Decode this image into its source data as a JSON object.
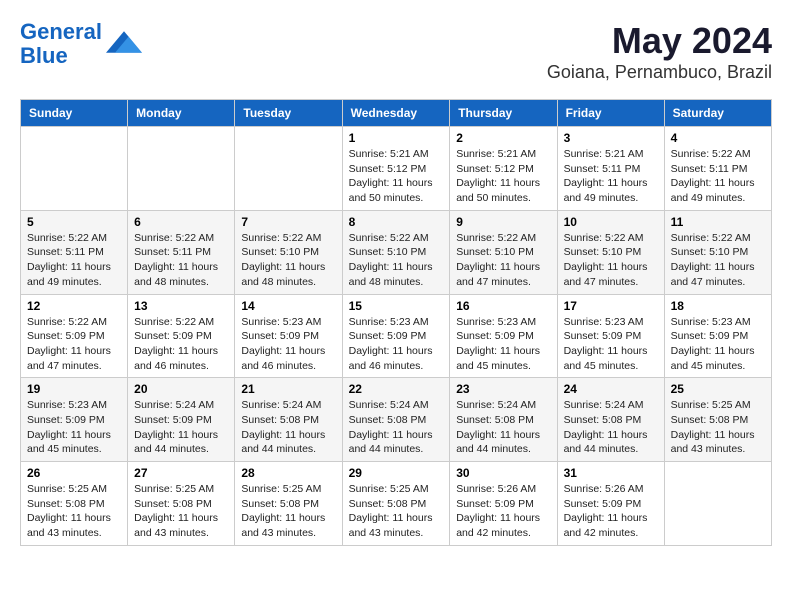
{
  "logo": {
    "line1": "General",
    "line2": "Blue"
  },
  "title": {
    "month_year": "May 2024",
    "location": "Goiana, Pernambuco, Brazil"
  },
  "days_of_week": [
    "Sunday",
    "Monday",
    "Tuesday",
    "Wednesday",
    "Thursday",
    "Friday",
    "Saturday"
  ],
  "weeks": [
    [
      {
        "day": "",
        "info": ""
      },
      {
        "day": "",
        "info": ""
      },
      {
        "day": "",
        "info": ""
      },
      {
        "day": "1",
        "info": "Sunrise: 5:21 AM\nSunset: 5:12 PM\nDaylight: 11 hours\nand 50 minutes."
      },
      {
        "day": "2",
        "info": "Sunrise: 5:21 AM\nSunset: 5:12 PM\nDaylight: 11 hours\nand 50 minutes."
      },
      {
        "day": "3",
        "info": "Sunrise: 5:21 AM\nSunset: 5:11 PM\nDaylight: 11 hours\nand 49 minutes."
      },
      {
        "day": "4",
        "info": "Sunrise: 5:22 AM\nSunset: 5:11 PM\nDaylight: 11 hours\nand 49 minutes."
      }
    ],
    [
      {
        "day": "5",
        "info": "Sunrise: 5:22 AM\nSunset: 5:11 PM\nDaylight: 11 hours\nand 49 minutes."
      },
      {
        "day": "6",
        "info": "Sunrise: 5:22 AM\nSunset: 5:11 PM\nDaylight: 11 hours\nand 48 minutes."
      },
      {
        "day": "7",
        "info": "Sunrise: 5:22 AM\nSunset: 5:10 PM\nDaylight: 11 hours\nand 48 minutes."
      },
      {
        "day": "8",
        "info": "Sunrise: 5:22 AM\nSunset: 5:10 PM\nDaylight: 11 hours\nand 48 minutes."
      },
      {
        "day": "9",
        "info": "Sunrise: 5:22 AM\nSunset: 5:10 PM\nDaylight: 11 hours\nand 47 minutes."
      },
      {
        "day": "10",
        "info": "Sunrise: 5:22 AM\nSunset: 5:10 PM\nDaylight: 11 hours\nand 47 minutes."
      },
      {
        "day": "11",
        "info": "Sunrise: 5:22 AM\nSunset: 5:10 PM\nDaylight: 11 hours\nand 47 minutes."
      }
    ],
    [
      {
        "day": "12",
        "info": "Sunrise: 5:22 AM\nSunset: 5:09 PM\nDaylight: 11 hours\nand 47 minutes."
      },
      {
        "day": "13",
        "info": "Sunrise: 5:22 AM\nSunset: 5:09 PM\nDaylight: 11 hours\nand 46 minutes."
      },
      {
        "day": "14",
        "info": "Sunrise: 5:23 AM\nSunset: 5:09 PM\nDaylight: 11 hours\nand 46 minutes."
      },
      {
        "day": "15",
        "info": "Sunrise: 5:23 AM\nSunset: 5:09 PM\nDaylight: 11 hours\nand 46 minutes."
      },
      {
        "day": "16",
        "info": "Sunrise: 5:23 AM\nSunset: 5:09 PM\nDaylight: 11 hours\nand 45 minutes."
      },
      {
        "day": "17",
        "info": "Sunrise: 5:23 AM\nSunset: 5:09 PM\nDaylight: 11 hours\nand 45 minutes."
      },
      {
        "day": "18",
        "info": "Sunrise: 5:23 AM\nSunset: 5:09 PM\nDaylight: 11 hours\nand 45 minutes."
      }
    ],
    [
      {
        "day": "19",
        "info": "Sunrise: 5:23 AM\nSunset: 5:09 PM\nDaylight: 11 hours\nand 45 minutes."
      },
      {
        "day": "20",
        "info": "Sunrise: 5:24 AM\nSunset: 5:09 PM\nDaylight: 11 hours\nand 44 minutes."
      },
      {
        "day": "21",
        "info": "Sunrise: 5:24 AM\nSunset: 5:08 PM\nDaylight: 11 hours\nand 44 minutes."
      },
      {
        "day": "22",
        "info": "Sunrise: 5:24 AM\nSunset: 5:08 PM\nDaylight: 11 hours\nand 44 minutes."
      },
      {
        "day": "23",
        "info": "Sunrise: 5:24 AM\nSunset: 5:08 PM\nDaylight: 11 hours\nand 44 minutes."
      },
      {
        "day": "24",
        "info": "Sunrise: 5:24 AM\nSunset: 5:08 PM\nDaylight: 11 hours\nand 44 minutes."
      },
      {
        "day": "25",
        "info": "Sunrise: 5:25 AM\nSunset: 5:08 PM\nDaylight: 11 hours\nand 43 minutes."
      }
    ],
    [
      {
        "day": "26",
        "info": "Sunrise: 5:25 AM\nSunset: 5:08 PM\nDaylight: 11 hours\nand 43 minutes."
      },
      {
        "day": "27",
        "info": "Sunrise: 5:25 AM\nSunset: 5:08 PM\nDaylight: 11 hours\nand 43 minutes."
      },
      {
        "day": "28",
        "info": "Sunrise: 5:25 AM\nSunset: 5:08 PM\nDaylight: 11 hours\nand 43 minutes."
      },
      {
        "day": "29",
        "info": "Sunrise: 5:25 AM\nSunset: 5:08 PM\nDaylight: 11 hours\nand 43 minutes."
      },
      {
        "day": "30",
        "info": "Sunrise: 5:26 AM\nSunset: 5:09 PM\nDaylight: 11 hours\nand 42 minutes."
      },
      {
        "day": "31",
        "info": "Sunrise: 5:26 AM\nSunset: 5:09 PM\nDaylight: 11 hours\nand 42 minutes."
      },
      {
        "day": "",
        "info": ""
      }
    ]
  ]
}
